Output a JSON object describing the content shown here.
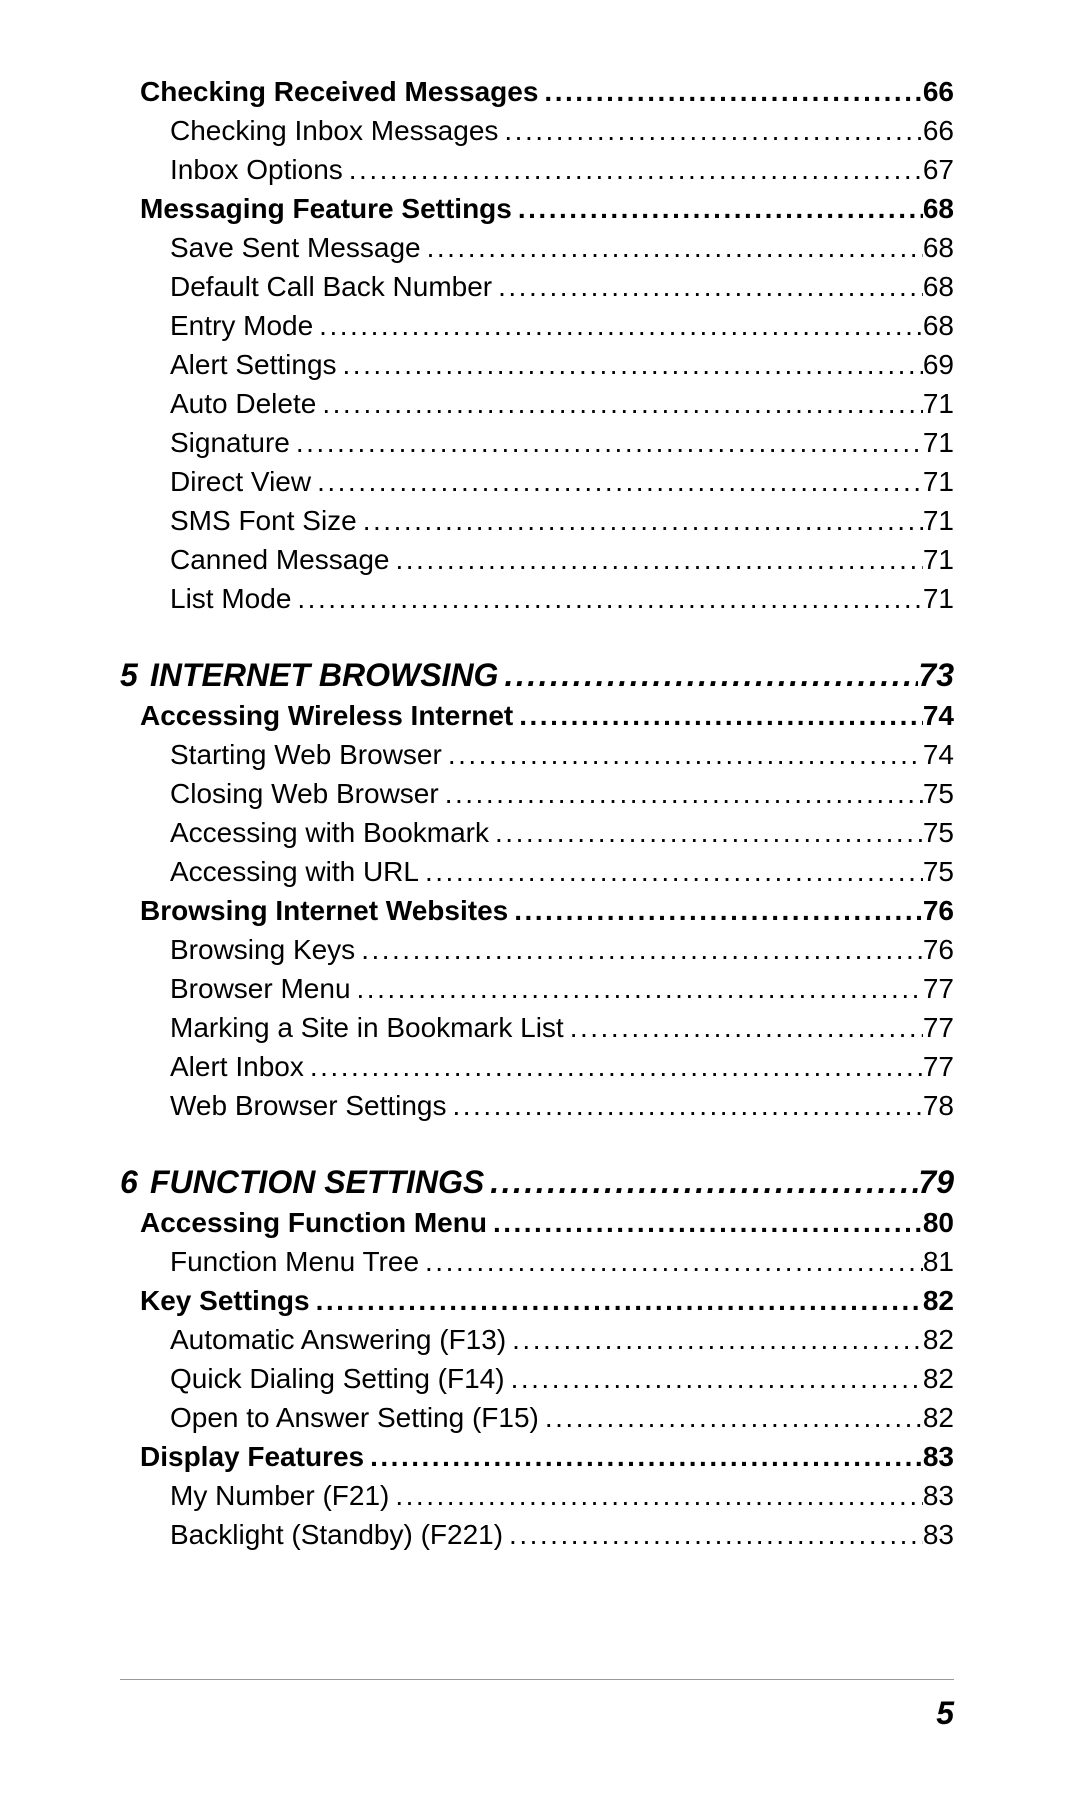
{
  "page_number": "5",
  "leader_fill": "....................................................................................................................................................................",
  "toc": [
    {
      "type": "section",
      "label": "Checking Received Messages",
      "page": "66"
    },
    {
      "type": "sub",
      "label": "Checking Inbox Messages",
      "page": "66"
    },
    {
      "type": "sub",
      "label": "Inbox Options",
      "page": "67"
    },
    {
      "type": "section",
      "label": "Messaging Feature Settings",
      "page": "68"
    },
    {
      "type": "sub",
      "label": "Save Sent Message",
      "page": "68"
    },
    {
      "type": "sub",
      "label": "Default Call Back Number",
      "page": "68"
    },
    {
      "type": "sub",
      "label": "Entry Mode",
      "page": "68"
    },
    {
      "type": "sub",
      "label": "Alert Settings",
      "page": "69"
    },
    {
      "type": "sub",
      "label": "Auto Delete",
      "page": "71"
    },
    {
      "type": "sub",
      "label": "Signature",
      "page": "71"
    },
    {
      "type": "sub",
      "label": "Direct View",
      "page": "71"
    },
    {
      "type": "sub",
      "label": "SMS Font Size",
      "page": "71"
    },
    {
      "type": "sub",
      "label": "Canned Message",
      "page": "71"
    },
    {
      "type": "sub",
      "label": "List Mode",
      "page": "71"
    },
    {
      "type": "chapter",
      "num": "5",
      "label": "INTERNET BROWSING",
      "page": "73"
    },
    {
      "type": "section",
      "label": "Accessing Wireless Internet",
      "page": "74"
    },
    {
      "type": "sub",
      "label": "Starting Web Browser",
      "page": "74"
    },
    {
      "type": "sub",
      "label": "Closing Web Browser",
      "page": "75"
    },
    {
      "type": "sub",
      "label": "Accessing with Bookmark",
      "page": "75"
    },
    {
      "type": "sub",
      "label": "Accessing with URL",
      "page": "75"
    },
    {
      "type": "section",
      "label": "Browsing Internet Websites",
      "page": "76"
    },
    {
      "type": "sub",
      "label": "Browsing Keys",
      "page": "76"
    },
    {
      "type": "sub",
      "label": "Browser Menu",
      "page": "77"
    },
    {
      "type": "sub",
      "label": "Marking a Site in Bookmark List",
      "page": "77"
    },
    {
      "type": "sub",
      "label": "Alert Inbox",
      "page": "77"
    },
    {
      "type": "sub",
      "label": "Web Browser Settings",
      "page": "78"
    },
    {
      "type": "chapter",
      "num": "6",
      "label": "FUNCTION SETTINGS",
      "page": "79"
    },
    {
      "type": "section",
      "label": "Accessing Function Menu",
      "page": "80"
    },
    {
      "type": "sub",
      "label": "Function Menu Tree",
      "page": "81"
    },
    {
      "type": "section",
      "label": "Key Settings",
      "page": "82"
    },
    {
      "type": "sub",
      "label": "Automatic Answering (F13)",
      "page": "82"
    },
    {
      "type": "sub",
      "label": "Quick Dialing Setting (F14)",
      "page": "82"
    },
    {
      "type": "sub",
      "label": "Open to Answer Setting (F15)",
      "page": "82"
    },
    {
      "type": "section",
      "label": "Display Features",
      "page": "83"
    },
    {
      "type": "sub",
      "label": "My Number (F21)",
      "page": "83"
    },
    {
      "type": "sub",
      "label": "Backlight (Standby) (F221)",
      "page": "83"
    }
  ]
}
